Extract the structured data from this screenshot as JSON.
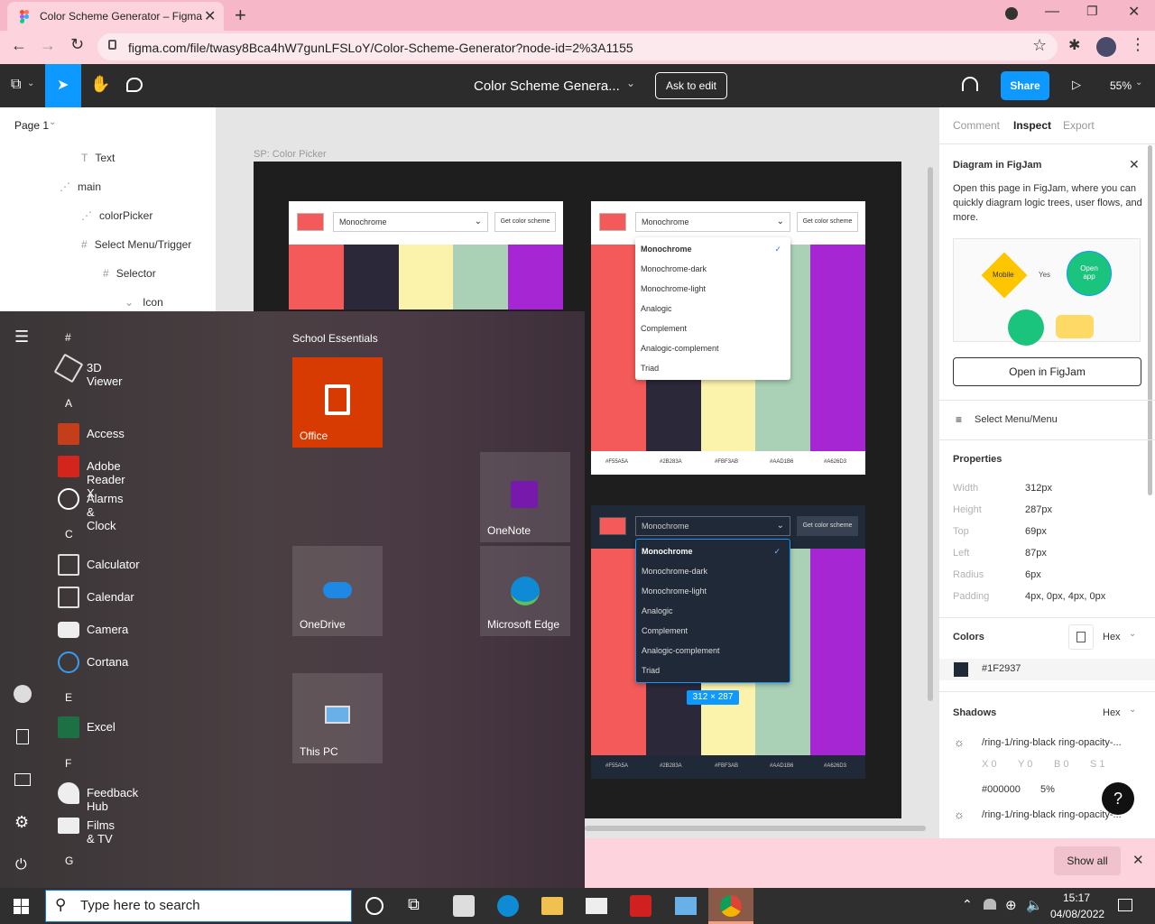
{
  "browser": {
    "tab_title": "Color Scheme Generator – Figma",
    "url": "figma.com/file/twasy8Bca4hW7gunLFSLoY/Color-Scheme-Generator?node-id=2%3A1155"
  },
  "figma": {
    "file_title": "Color Scheme Genera...",
    "ask_to_edit": "Ask to edit",
    "share": "Share",
    "zoom": "55%",
    "page": "Page 1",
    "layers": [
      {
        "label": "Text",
        "icon": "text-icon"
      },
      {
        "label": "main",
        "icon": "frame-dashed-icon"
      },
      {
        "label": "colorPicker",
        "icon": "frame-dashed-icon"
      },
      {
        "label": "Select Menu/Trigger",
        "icon": "frame-hash-icon"
      },
      {
        "label": "Selector",
        "icon": "frame-hash-icon"
      },
      {
        "label": "Icon",
        "icon": "chevron-down-icon"
      }
    ],
    "frame_label": "SP: Color Picker",
    "card": {
      "select_value": "Monochrome",
      "button": "Get color scheme",
      "colors": [
        "#F55A5A",
        "#2B283A",
        "#FBF3AB",
        "#AAD1B6",
        "#A626D3"
      ],
      "hex_labels": [
        "#F55A5A",
        "#2B283A",
        "#FBF3AB",
        "#AAD1B6",
        "#A626D3"
      ]
    },
    "menu_options": [
      "Monochrome",
      "Monochrome-dark",
      "Monochrome-light",
      "Analogic",
      "Complement",
      "Analogic-complement",
      "Triad"
    ],
    "dimension_badge": "312 × 287"
  },
  "inspect": {
    "tabs": [
      "Comment",
      "Inspect",
      "Export"
    ],
    "banner_title": "Diagram in FigJam",
    "banner_text": "Open this page in FigJam, where you can quickly diagram logic trees, user flows, and more.",
    "diagram_mobile": "Mobile",
    "diagram_yes": "Yes",
    "diagram_open_app": "Open app",
    "open_figjam": "Open in FigJam",
    "component": "Select Menu/Menu",
    "properties_title": "Properties",
    "properties": [
      {
        "label": "Width",
        "value": "312px"
      },
      {
        "label": "Height",
        "value": "287px"
      },
      {
        "label": "Top",
        "value": "69px"
      },
      {
        "label": "Left",
        "value": "87px"
      },
      {
        "label": "Radius",
        "value": "6px"
      },
      {
        "label": "Padding",
        "value": "4px, 0px, 4px, 0px"
      }
    ],
    "colors_title": "Colors",
    "color_format": "Hex",
    "color_value": "#1F2937",
    "shadows_title": "Shadows",
    "shadows_format": "Hex",
    "shadow1": "/ring-1/ring-black ring-opacity-...",
    "shadow1_x": "X 0",
    "shadow1_y": "Y 0",
    "shadow1_b": "B 0",
    "shadow1_s": "S 1",
    "shadow_color": "#000000",
    "shadow_opacity": "5%",
    "shadow2": "/ring-1/ring-black ring-opacity-...",
    "help": "?"
  },
  "start_menu": {
    "tiles_group": "School Essentials",
    "tiles": [
      "Office",
      "OneNote",
      "OneDrive",
      "Microsoft Edge",
      "This PC"
    ],
    "letters": [
      "#",
      "A",
      "C",
      "E",
      "F",
      "G"
    ],
    "apps": [
      "3D Viewer",
      "Access",
      "Adobe Reader X",
      "Alarms & Clock",
      "Calculator",
      "Calendar",
      "Camera",
      "Cortana",
      "Excel",
      "Feedback Hub",
      "Films & TV"
    ]
  },
  "download_bar": {
    "show_all": "Show all"
  },
  "taskbar": {
    "search_placeholder": "Type here to search",
    "time": "15:17",
    "date": "04/08/2022"
  }
}
